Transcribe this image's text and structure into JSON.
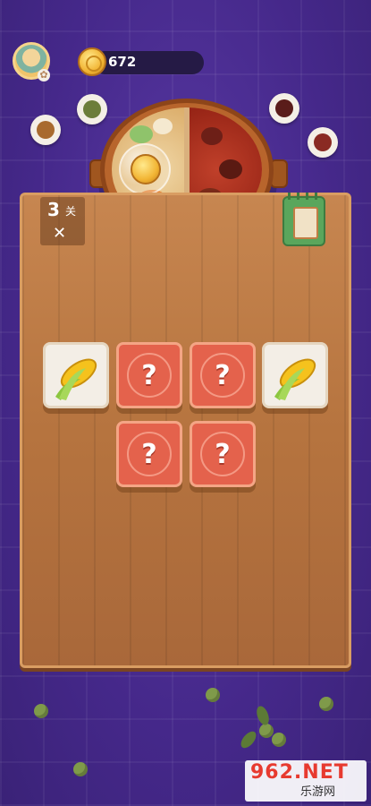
{
  "header": {
    "coins": "672",
    "icons": [
      "avatar",
      "gear-icon",
      "coin-icon"
    ]
  },
  "level": {
    "number": "3",
    "unit": "关",
    "icon": "cutlery-icon"
  },
  "deck_button": {
    "icon": "cards-icon"
  },
  "tiles": [
    {
      "row": 1,
      "col": 1,
      "state": "revealed",
      "item": "corn-icon"
    },
    {
      "row": 1,
      "col": 2,
      "state": "hidden",
      "symbol": "?"
    },
    {
      "row": 1,
      "col": 3,
      "state": "hidden",
      "symbol": "?"
    },
    {
      "row": 1,
      "col": 4,
      "state": "revealed",
      "item": "corn-icon"
    },
    {
      "row": 2,
      "col": 2,
      "state": "hidden",
      "symbol": "?"
    },
    {
      "row": 2,
      "col": 3,
      "state": "hidden",
      "symbol": "?"
    }
  ],
  "watermark": {
    "main": "962.NET",
    "sub": "乐游网"
  },
  "colors": {
    "background": "#4b3190",
    "board": "#b6743f",
    "hidden_tile": "#e4624c",
    "revealed_tile": "#f3eee6"
  }
}
